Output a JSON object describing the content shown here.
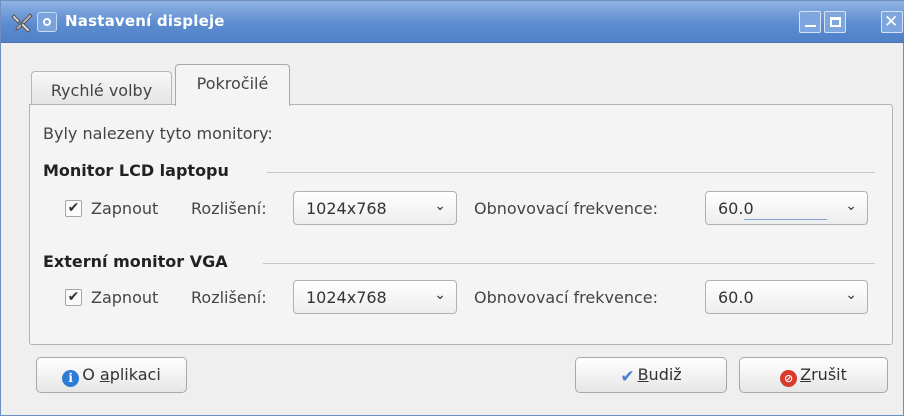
{
  "window": {
    "title": "Nastavení displeje",
    "colors": {
      "titlebar": "#5d8cd0",
      "background": "#efefef"
    }
  },
  "tabs": [
    {
      "label": "Rychlé volby",
      "active": false
    },
    {
      "label": "Pokročilé",
      "active": true
    }
  ],
  "panel": {
    "intro": "Byly nalezeny tyto monitory:",
    "monitors": [
      {
        "name": "Monitor LCD laptopu",
        "enabled": true,
        "enable_label": "Zapnout",
        "resolution_label": "Rozlišení:",
        "resolution": "1024x768",
        "refresh_label": "Obnovovací frekvence:",
        "refresh": "60.0"
      },
      {
        "name": "Externí monitor VGA",
        "enabled": true,
        "enable_label": "Zapnout",
        "resolution_label": "Rozlišení:",
        "resolution": "1024x768",
        "refresh_label": "Obnovovací frekvence:",
        "refresh": "60.0"
      }
    ]
  },
  "buttons": {
    "about_prefix": "O ",
    "about_mnemonic": "a",
    "about_rest": "plikaci",
    "ok_mnemonic": "B",
    "ok_rest": "udiž",
    "cancel_mnemonic": "Z",
    "cancel_rest": "rušit"
  },
  "icons": {
    "about": "info-icon",
    "ok": "checkmark-icon",
    "cancel": "cancel-icon",
    "app": "tools-icon"
  }
}
